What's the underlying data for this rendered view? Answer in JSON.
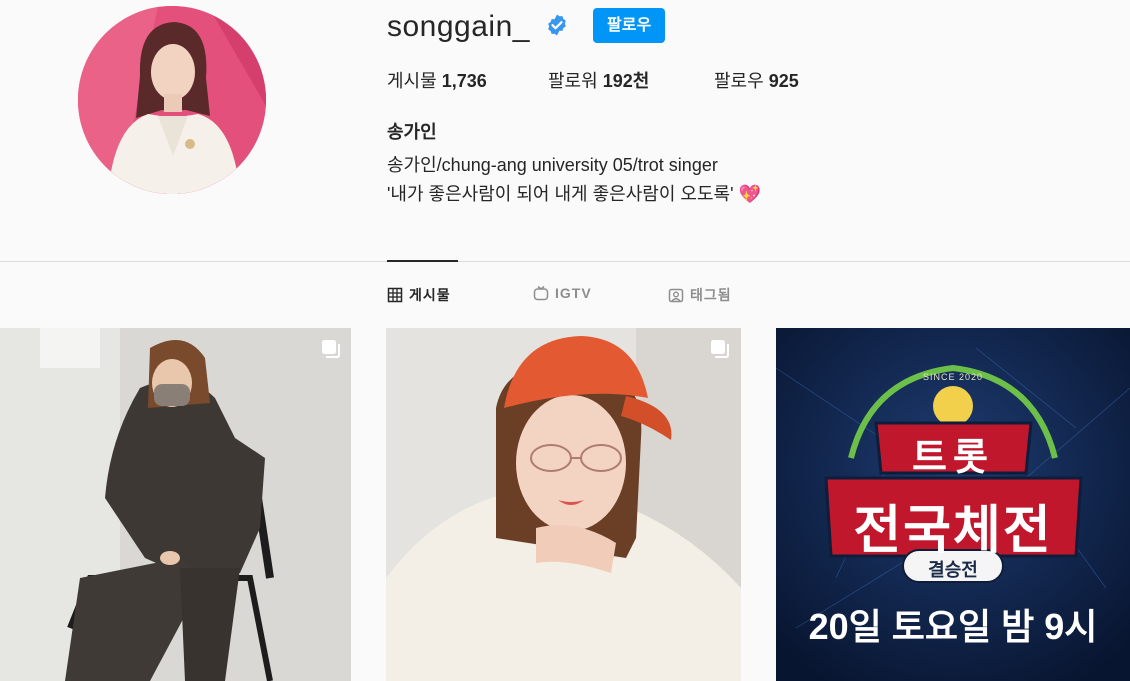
{
  "profile": {
    "username": "songgain_",
    "verified": true,
    "follow_label": "팔로우",
    "stats": [
      {
        "label": "게시물",
        "value": "1,736"
      },
      {
        "label": "팔로워",
        "value": "192천"
      },
      {
        "label": "팔로우",
        "value": "925"
      }
    ],
    "bio": {
      "name": "송가인",
      "line1": "송가인/chung-ang university 05/trot singer",
      "line2": "'내가 좋은사람이 되어 내게 좋은사람이 오도록'",
      "emoji": "💖"
    }
  },
  "tabs": [
    {
      "label": "게시물",
      "icon": "grid-icon",
      "active": true
    },
    {
      "label": "IGTV",
      "icon": "igtv-icon",
      "active": false
    },
    {
      "label": "태그됨",
      "icon": "tagged-icon",
      "active": false
    }
  ],
  "posts": [
    {
      "type": "photo",
      "multi": true
    },
    {
      "type": "photo",
      "multi": true
    },
    {
      "type": "graphic",
      "multi": false,
      "text": {
        "top": "SINCE 2020",
        "title1": "트롯",
        "title2": "전국체전",
        "badge": "결승전",
        "bottom": "20일 토요일 밤 9시"
      }
    }
  ],
  "colors": {
    "accent": "#0095f6",
    "text": "#262626",
    "muted": "#8e8e8e",
    "divider": "#dbdbdb",
    "background": "#fafafa"
  }
}
